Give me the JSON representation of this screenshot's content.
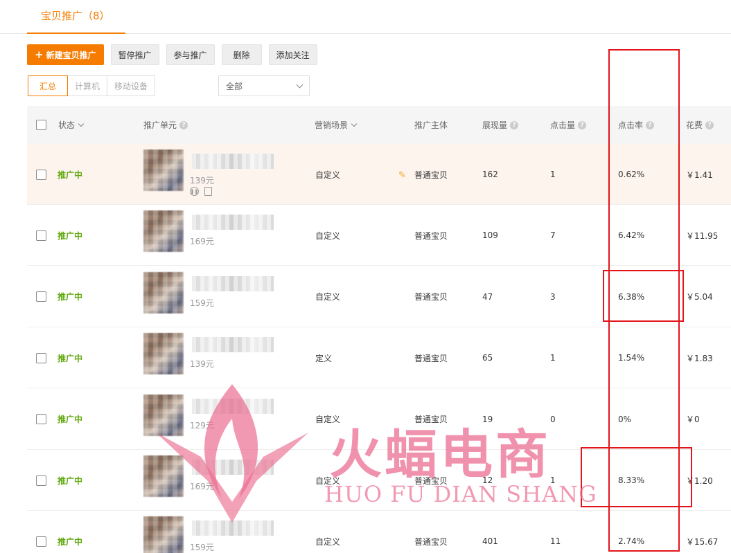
{
  "tab": {
    "label": "宝贝推广（8）"
  },
  "toolbar": {
    "new_label": "新建宝贝推广",
    "pause_label": "暂停推广",
    "join_label": "参与推广",
    "delete_label": "删除",
    "follow_label": "添加关注"
  },
  "device_tabs": [
    "汇总",
    "计算机",
    "移动设备"
  ],
  "filter_select": {
    "value": "全部"
  },
  "columns": {
    "status": "状态",
    "unit": "推广单元",
    "scene": "营销场景",
    "subject": "推广主体",
    "impressions": "展现量",
    "clicks": "点击量",
    "ctr": "点击率",
    "cost": "花费"
  },
  "rows": [
    {
      "status": "推广中",
      "price": "139元",
      "scene": "自定义",
      "subject": "普通宝贝",
      "impressions": "162",
      "clicks": "1",
      "ctr": "0.62%",
      "cost": "￥1.41"
    },
    {
      "status": "推广中",
      "price": "169元",
      "scene": "自定义",
      "subject": "普通宝贝",
      "impressions": "109",
      "clicks": "7",
      "ctr": "6.42%",
      "cost": "￥11.95"
    },
    {
      "status": "推广中",
      "price": "159元",
      "scene": "自定义",
      "subject": "普通宝贝",
      "impressions": "47",
      "clicks": "3",
      "ctr": "6.38%",
      "cost": "￥5.04"
    },
    {
      "status": "推广中",
      "price": "139元",
      "scene": "定义",
      "subject": "普通宝贝",
      "impressions": "65",
      "clicks": "1",
      "ctr": "1.54%",
      "cost": "￥1.83"
    },
    {
      "status": "推广中",
      "price": "129元",
      "scene": "自定义",
      "subject": "普通宝贝",
      "impressions": "19",
      "clicks": "0",
      "ctr": "0%",
      "cost": "￥0"
    },
    {
      "status": "推广中",
      "price": "169元",
      "scene": "自定义",
      "subject": "普通宝贝",
      "impressions": "12",
      "clicks": "1",
      "ctr": "8.33%",
      "cost": "￥1.20"
    },
    {
      "status": "推广中",
      "price": "159元",
      "scene": "自定义",
      "subject": "普通宝贝",
      "impressions": "401",
      "clicks": "11",
      "ctr": "2.74%",
      "cost": "￥15.67"
    }
  ],
  "watermark": {
    "title": "火蝠电商",
    "subtitle": "HUO FU DIAN SHANG"
  },
  "colors": {
    "accent": "#f57c00",
    "status_green": "#62a80f",
    "annotation_red": "#e3141a",
    "watermark_pink": "#eb6e91"
  }
}
